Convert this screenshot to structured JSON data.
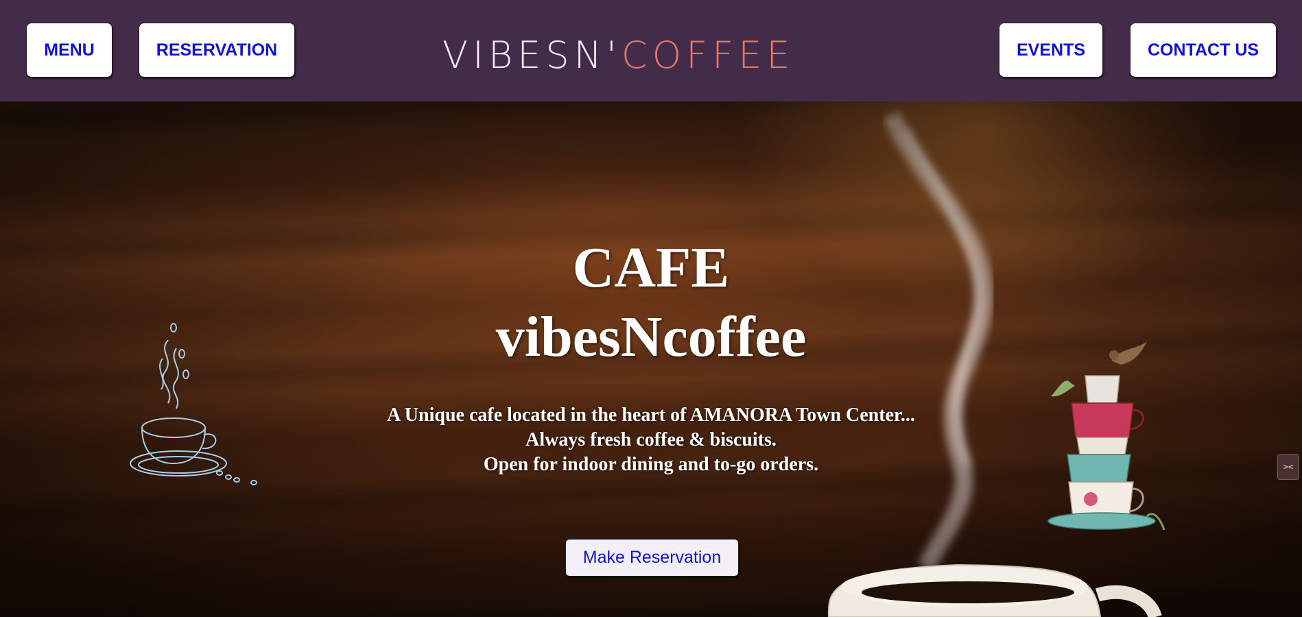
{
  "nav": {
    "left": [
      {
        "label": "MENU"
      },
      {
        "label": "RESERVATION"
      }
    ],
    "right": [
      {
        "label": "EVENTS"
      },
      {
        "label": "CONTACT US"
      }
    ]
  },
  "logo": {
    "part1": "VIBESN'",
    "part2": "COFFEE"
  },
  "hero": {
    "title_line1": "CAFE",
    "title_line2": "vibesNcoffee",
    "description": [
      "A Unique cafe located in the heart of AMANORA Town Center...",
      "Always fresh coffee & biscuits.",
      "Open for indoor dining and to-go orders."
    ],
    "cta_label": "Make Reservation"
  },
  "colors": {
    "header_bg": "#432b4a",
    "nav_text": "#1010d8",
    "logo_accent": "#e07a6a",
    "sketch_blue": "#a9cfe8"
  },
  "icons": [
    "coffee-cup-sketch-icon",
    "stacked-teacups-bird-icon",
    "steaming-coffee-cup-icon",
    "side-widget-icon"
  ]
}
